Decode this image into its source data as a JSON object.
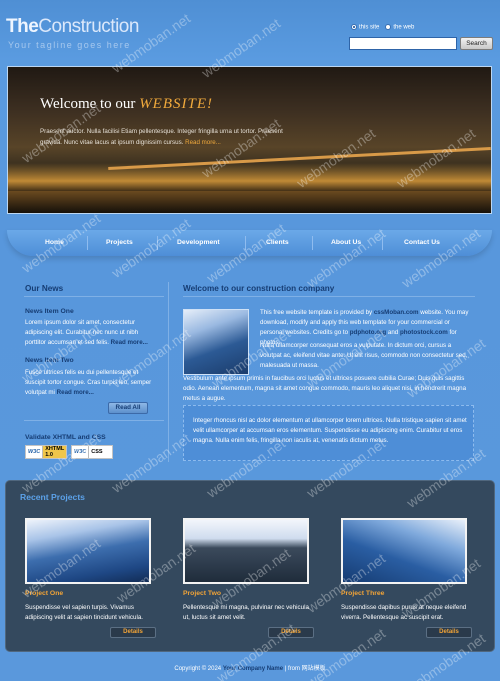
{
  "site": {
    "logo_bold": "The",
    "logo_rest": "Construction",
    "tagline": "Your tagline goes here"
  },
  "search": {
    "option_site": "this site",
    "option_web": "the web",
    "value": "",
    "button": "Search"
  },
  "banner": {
    "title_prefix": "Welcome to our ",
    "title_highlight": "WEBSITE!",
    "text": "Praesent auctor. Nulla facilisi Etiam pellentesque. Integer fringilla urna ut tortor. Praesent gravida. Nunc vitae lacus at ipsum dignissim cursus.",
    "read_more": "Read more..."
  },
  "nav": [
    "Home",
    "Projects",
    "Development",
    "Clients",
    "About Us",
    "Contact Us"
  ],
  "news": {
    "heading": "Our News",
    "items": [
      {
        "title": "News Item One",
        "text": "Lorem ipsum dolor sit amet, consectetur adipiscing elit. Curabitur nec nunc ut nibh porttitor accumsan et sed felis.",
        "more": "Read more..."
      },
      {
        "title": "News Item Two",
        "text": "Fusce ultrices felis eu dui pellentesque et suscipit tortor congue. Cras turpis leo, semper volutpat mi",
        "more": "Read more..."
      }
    ],
    "read_all": "Read All",
    "validate": "Validate XHTML and CSS",
    "badges": [
      {
        "w3": "W3C",
        "label": "XHTML 1.0"
      },
      {
        "w3": "W3C",
        "label": "CSS"
      }
    ]
  },
  "welcome": {
    "heading": "Welcome to our construction company",
    "p1_before": "This free website template is provided by ",
    "p1_link1": "cssMoban.com",
    "p1_mid": " website. You may download, modify and apply this web template for your commercial or personal websites. Credits go to ",
    "p1_link2": "pdphoto.org",
    "p1_and": " and ",
    "p1_link3": "photostock.com",
    "p1_end": " for photos.",
    "p2": "Nulla ullamcorper consequat eros a vulputate. In dictum orci, cursus a volutpat ac, eleifend vitae ante. Ut elit risus, commodo non consectetur sed, malesuada ut massa.",
    "p3": "Vestibulum ante ipsum primis in faucibus orci luctus et ultrices posuere cubilia Curae; Duis quis sagittis odio. Aenean elementum, magna sit amet congue commodo, mauris leo aliquet nisi, in hendrerit magna metus a augue.",
    "quote": "Integer rhoncus nisl ac dolor elementum at ullamcorper lorem ultrices. Nulla tristique sapien sit amet velit ullamcorper at accumsan eros elementum. Suspendisse eu adipiscing enim. Curabitur ut eros magna. Nulla enim felis, fringilla non iaculis at, venenatis dictum metus."
  },
  "projects": {
    "heading": "Recent Projects",
    "items": [
      {
        "title": "Project One",
        "desc": "Suspendisse vel sapien turpis. Vivamus adipiscing velit at sapien tincidunt vehicula.",
        "button": "Details"
      },
      {
        "title": "Project Two",
        "desc": "Pellentesque mi magna, pulvinar nec vehicula ut, luctus sit amet velit.",
        "button": "Details"
      },
      {
        "title": "Project Three",
        "desc": "Suspendisse dapibus purus at neque eleifend viverra. Pellentesque ac suscipit erat.",
        "button": "Details"
      }
    ]
  },
  "footer": {
    "prefix": "Copyright © 2024 ",
    "company": "Your Company Name",
    "mid": " | from ",
    "link": "网站模板"
  },
  "watermark": "webmoban.net"
}
